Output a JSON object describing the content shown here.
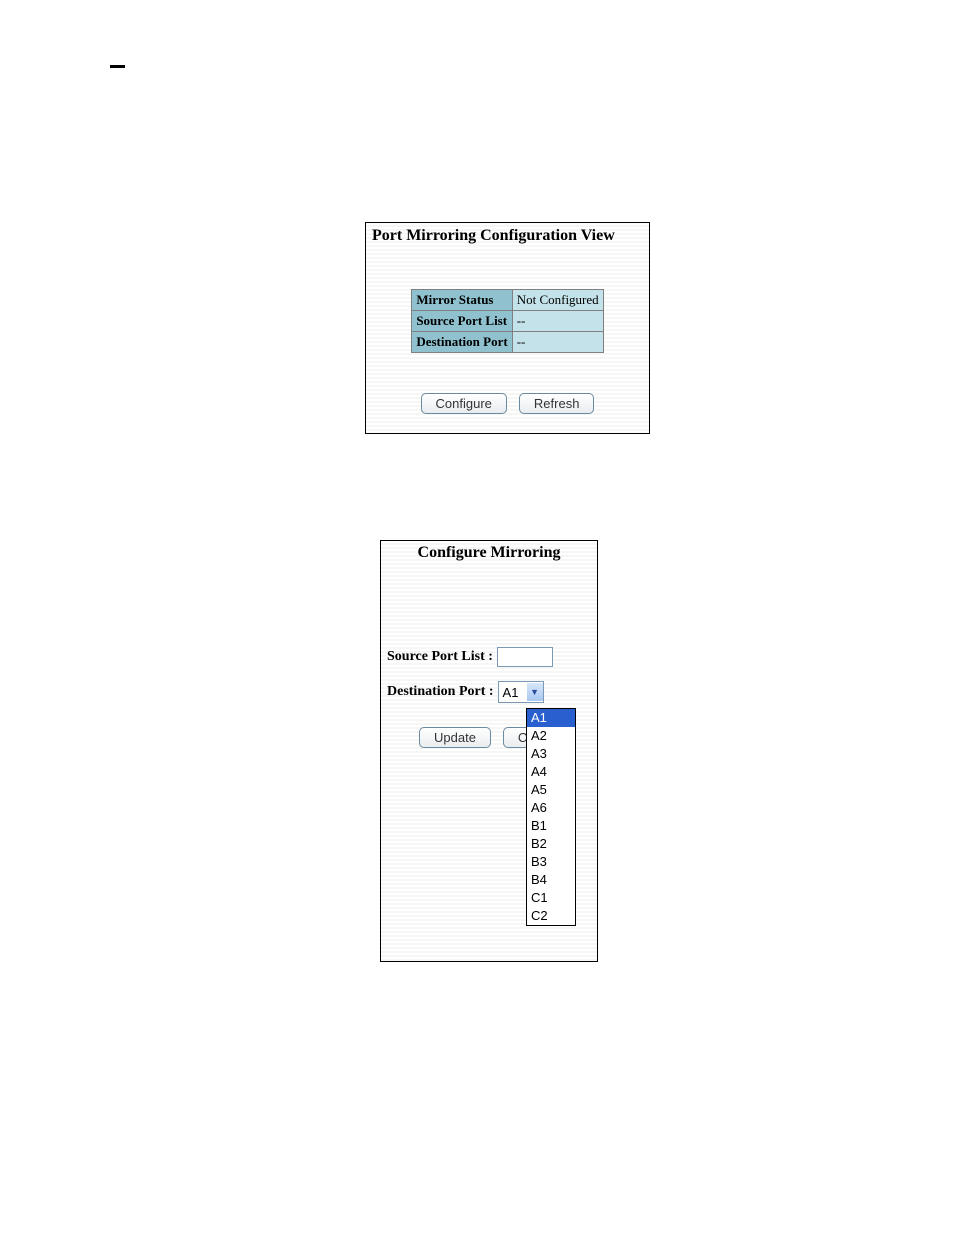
{
  "panel1": {
    "title": "Port Mirroring Configuration View",
    "rows": [
      {
        "label": "Mirror Status",
        "value": "Not Configured"
      },
      {
        "label": "Source Port List",
        "value": "--"
      },
      {
        "label": "Destination Port",
        "value": "--"
      }
    ],
    "buttons": {
      "configure": "Configure",
      "refresh": "Refresh"
    }
  },
  "panel2": {
    "title": "Configure Mirroring",
    "source_label": "Source Port List :",
    "source_value": "",
    "dest_label": "Destination Port :",
    "dest_selected": "A1",
    "buttons": {
      "update": "Update",
      "cancel": "Cancel"
    },
    "options": [
      "A1",
      "A2",
      "A3",
      "A4",
      "A5",
      "A6",
      "B1",
      "B2",
      "B3",
      "B4",
      "C1",
      "C2"
    ]
  }
}
